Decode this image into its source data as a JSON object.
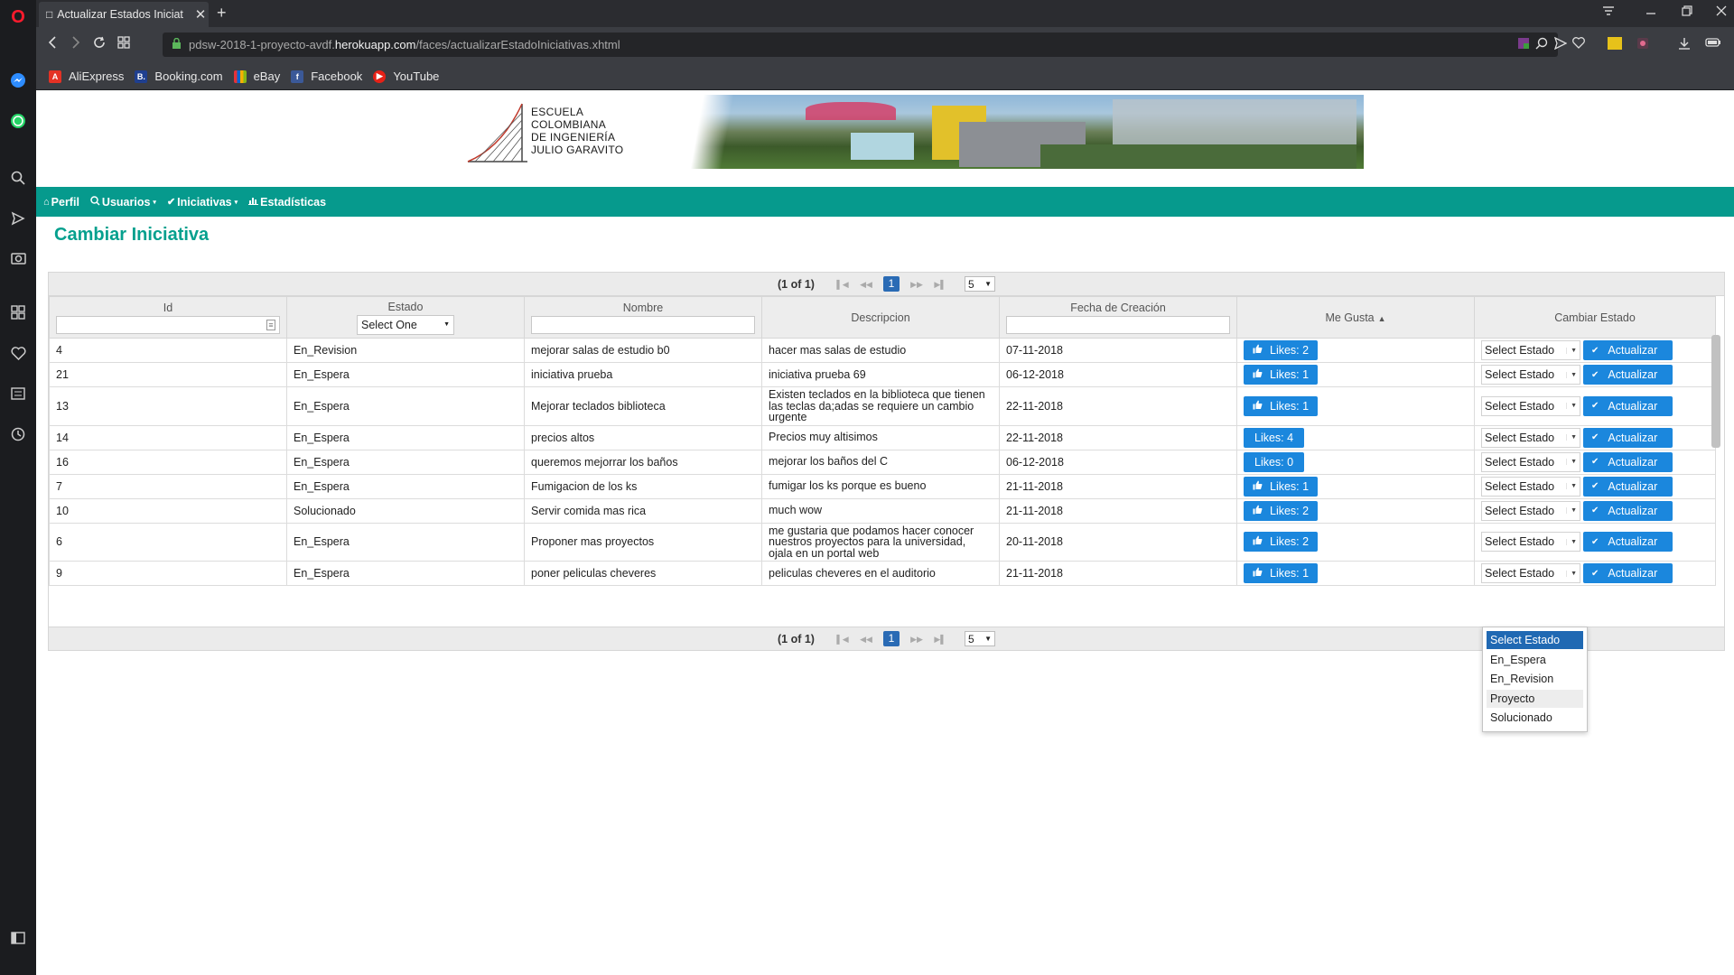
{
  "browser": {
    "tab_title": "Actualizar Estados Iniciat",
    "tab_close": "✕",
    "new_tab": "+",
    "url_prefix": "pdsw-2018-1-proyecto-avdf.",
    "url_domain": "herokuapp.com",
    "url_path": "/faces/actualizarEstadoIniciativas.xhtml",
    "bookmarks": [
      {
        "label": "AliExpress",
        "icon": "aliexpress-icon",
        "color": "#e43225"
      },
      {
        "label": "Booking.com",
        "icon": "booking-icon",
        "color": "#1f3f8f"
      },
      {
        "label": "eBay",
        "icon": "ebay-icon",
        "color": "#e53238"
      },
      {
        "label": "Facebook",
        "icon": "facebook-icon",
        "color": "#3b5998"
      },
      {
        "label": "YouTube",
        "icon": "youtube-icon",
        "color": "#e62117"
      }
    ]
  },
  "banner": {
    "school_line1": "ESCUELA",
    "school_line2": "COLOMBIANA",
    "school_line3": "DE INGENIERÍA",
    "school_line4": "JULIO GARAVITO"
  },
  "nav": {
    "perfil": "Perfil",
    "usuarios": "Usuarios",
    "iniciativas": "Iniciativas",
    "estadisticas": "Estadísticas"
  },
  "page_title": "Cambiar Iniciativa",
  "paginator": {
    "current": "(1 of 1)",
    "page": "1",
    "rows_per_page": "5"
  },
  "table": {
    "headers": {
      "id": "Id",
      "estado": "Estado",
      "nombre": "Nombre",
      "descripcion": "Descripcion",
      "fecha": "Fecha de Creación",
      "me_gusta": "Me Gusta",
      "cambiar_estado": "Cambiar Estado"
    },
    "estado_filter": "Select One",
    "select_estado": "Select Estado",
    "actualizar": "Actualizar",
    "rows": [
      {
        "id": "4",
        "estado": "En_Revision",
        "nombre": "mejorar salas de estudio b0",
        "descripcion": "hacer mas salas de estudio",
        "fecha": "07-11-2018",
        "likes": "Likes: 2",
        "thumb": true
      },
      {
        "id": "21",
        "estado": "En_Espera",
        "nombre": "iniciativa prueba",
        "descripcion": "iniciativa prueba 69",
        "fecha": "06-12-2018",
        "likes": "Likes: 1",
        "thumb": true
      },
      {
        "id": "13",
        "estado": "En_Espera",
        "nombre": "Mejorar teclados biblioteca",
        "descripcion": "Existen teclados en la biblioteca que tienen las teclas da;adas se requiere un cambio urgente",
        "fecha": "22-11-2018",
        "likes": "Likes: 1",
        "thumb": true
      },
      {
        "id": "14",
        "estado": "En_Espera",
        "nombre": "precios altos",
        "descripcion": "Precios muy altisimos",
        "fecha": "22-11-2018",
        "likes": "Likes: 4",
        "thumb": false
      },
      {
        "id": "16",
        "estado": "En_Espera",
        "nombre": "queremos mejorrar los baños",
        "descripcion": "mejorar los baños del C",
        "fecha": "06-12-2018",
        "likes": "Likes: 0",
        "thumb": false
      },
      {
        "id": "7",
        "estado": "En_Espera",
        "nombre": "Fumigacion de los ks",
        "descripcion": "fumigar los ks porque es bueno",
        "fecha": "21-11-2018",
        "likes": "Likes: 1",
        "thumb": true
      },
      {
        "id": "10",
        "estado": "Solucionado",
        "nombre": "Servir comida mas rica",
        "descripcion": "much wow",
        "fecha": "21-11-2018",
        "likes": "Likes: 2",
        "thumb": true
      },
      {
        "id": "6",
        "estado": "En_Espera",
        "nombre": "Proponer mas proyectos",
        "descripcion": "me gustaria que podamos hacer conocer nuestros proyectos para la universidad, ojala en un portal web",
        "fecha": "20-11-2018",
        "likes": "Likes: 2",
        "thumb": true
      },
      {
        "id": "9",
        "estado": "En_Espera",
        "nombre": "poner peliculas cheveres",
        "descripcion": "peliculas cheveres en el auditorio",
        "fecha": "21-11-2018",
        "likes": "Likes: 1",
        "thumb": true
      }
    ]
  },
  "dropdown": {
    "options": [
      "Select Estado",
      "En_Espera",
      "En_Revision",
      "Proyecto",
      "Solucionado"
    ],
    "selected": "Select Estado",
    "hovered": "Proyecto"
  },
  "colors": {
    "navbar": "#069a8d",
    "title": "#05a08e",
    "button": "#1b87dd",
    "page_active": "#2a6bb5"
  }
}
